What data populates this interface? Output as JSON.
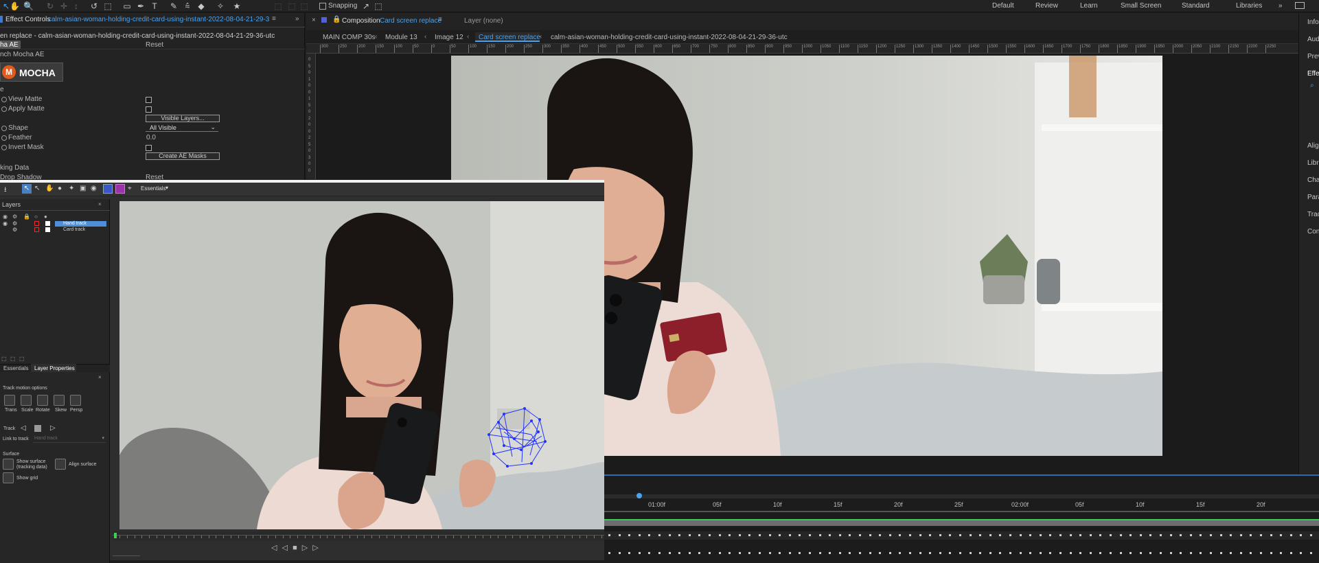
{
  "toolbar": {
    "snapping_label": "Snapping",
    "workspaces": [
      "Default",
      "Review",
      "Learn",
      "Small Screen",
      "Standard",
      "Libraries"
    ]
  },
  "effect_controls": {
    "tab_label": "Effect Controls",
    "layer_name": "calm-asian-woman-holding-credit-card-using-instant-2022-08-04-21-29-36-utc",
    "breadcrumb": "en replace - calm-asian-woman-holding-credit-card-using-instant-2022-08-04-21-29-36-utc",
    "effect_name": "ha AE",
    "reset_label": "Reset",
    "launch_label": "nch Mocha AE",
    "logo_text": "MOCHA",
    "matte_section": "e",
    "view_matte": "View Matte",
    "apply_matte": "Apply Matte",
    "visible_layers_button": "Visible Layers...",
    "shape_label": "Shape",
    "shape_value": "All Visible",
    "feather_label": "Feather",
    "feather_value": "0.0",
    "invert_mask": "Invert Mask",
    "create_masks_button": "Create AE Masks",
    "tracking_data": "king Data",
    "drop_shadow": "Drop Shadow",
    "drop_shadow_reset": "Reset"
  },
  "composition": {
    "tab_prefix": "Composition",
    "tab_name": "Card screen replace",
    "layer_label": "Layer (none)",
    "breadcrumbs": [
      "MAIN COMP 30s",
      "Module 13",
      "Image 12",
      "Card screen replace",
      "calm-asian-woman-holding-credit-card-using-instant-2022-08-04-21-29-36-utc"
    ],
    "ruler_labels": [
      "300",
      "250",
      "200",
      "150",
      "100",
      "50",
      "0",
      "50",
      "100",
      "150",
      "200",
      "250",
      "300",
      "350",
      "400",
      "450",
      "500",
      "550",
      "600",
      "650",
      "700",
      "750",
      "800",
      "850",
      "900",
      "950",
      "1000",
      "1050",
      "1100",
      "1150",
      "1200",
      "1250",
      "1300",
      "1350",
      "1400",
      "1450",
      "1500",
      "1550",
      "1600",
      "1650",
      "1700",
      "1750",
      "1800",
      "1850",
      "1900",
      "1950",
      "2000",
      "2050",
      "2100",
      "2150",
      "2200",
      "2250"
    ],
    "vruler_labels": [
      "0",
      "5",
      "0",
      "1",
      "0",
      "0",
      "1",
      "5",
      "0",
      "2",
      "0",
      "0",
      "2",
      "5",
      "0",
      "3",
      "0",
      "0"
    ]
  },
  "mocha": {
    "workspace_label": "Essentials",
    "layers_title": "Layers",
    "layers": [
      "Hand track",
      "Card track"
    ],
    "tabs": [
      "Essentials",
      "Layer Properties"
    ],
    "track_motion_options": "Track motion options",
    "motion_buttons": [
      "Trans",
      "Scale",
      "Rotate",
      "Skew",
      "Persp"
    ],
    "track_label": "Track",
    "link_to_track_label": "Link to track",
    "link_to_track_value": "Hand track",
    "surface_label": "Surface",
    "show_surface_label": "Show surface (tracking data)",
    "align_surface_label": "Align surface",
    "show_grid_label": "Show grid"
  },
  "right_panels": [
    "Info",
    "Aud",
    "Prev",
    "Effe",
    "Alig",
    "Libr",
    "Char",
    "Para",
    "Trac",
    "Con"
  ],
  "timeline": {
    "ticks": [
      "01:00f",
      "05f",
      "10f",
      "15f",
      "20f",
      "25f",
      "02:00f",
      "05f",
      "10f",
      "15f",
      "20f"
    ]
  },
  "colors": {
    "accent": "#4aa3f0",
    "panel_bg": "#232323",
    "track_points": "#2233ff"
  }
}
